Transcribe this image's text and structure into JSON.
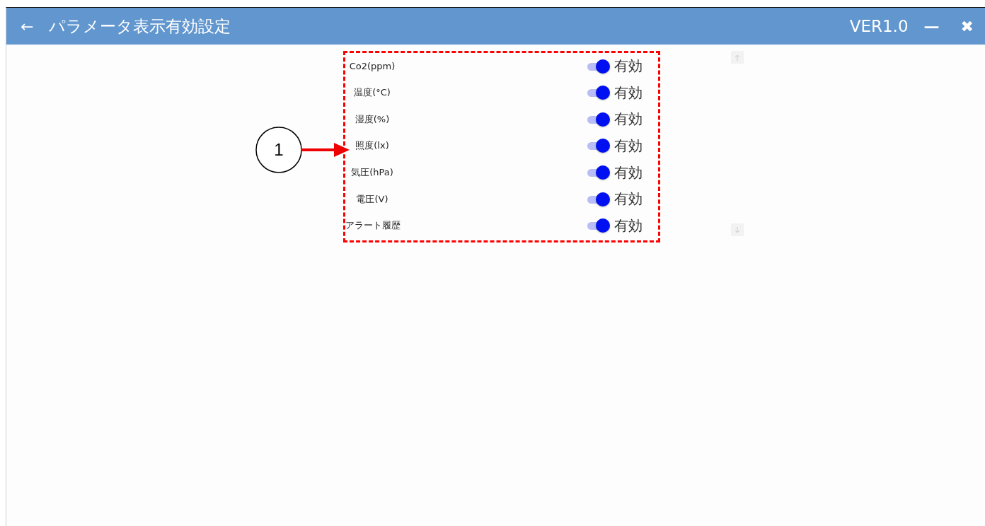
{
  "header": {
    "back": "←",
    "title": "パラメータ表示有効設定",
    "version": "VER1.0",
    "minimize": "—",
    "close": "✖"
  },
  "annotation": {
    "number": "1"
  },
  "parameters": [
    {
      "label": "Co2(ppm)",
      "on": true,
      "state_label": "有効"
    },
    {
      "label": "温度(°C)",
      "on": true,
      "state_label": "有効"
    },
    {
      "label": "湿度(%)",
      "on": true,
      "state_label": "有効"
    },
    {
      "label": "照度(lx)",
      "on": true,
      "state_label": "有効"
    },
    {
      "label": "気圧(hPa)",
      "on": true,
      "state_label": "有効"
    },
    {
      "label": "電圧(V)",
      "on": true,
      "state_label": "有効"
    },
    {
      "label": "アラート履歴",
      "on": true,
      "state_label": "有効"
    }
  ]
}
